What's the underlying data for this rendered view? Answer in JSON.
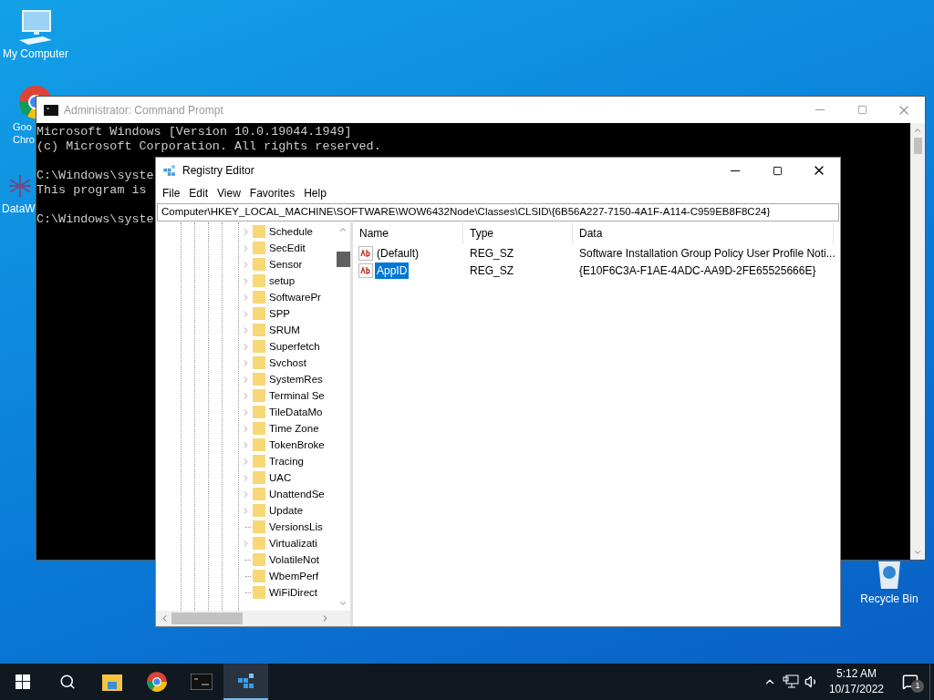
{
  "desktop_icons": [
    {
      "kind": "computer",
      "lines": [
        "My Computer"
      ]
    },
    {
      "kind": "chrome",
      "lines": [
        "Goo",
        "Chro"
      ]
    },
    {
      "kind": "datawave",
      "lines": [
        "DataW"
      ]
    },
    {
      "kind": "recycle",
      "lines": [
        "Recycle Bin"
      ]
    }
  ],
  "console": {
    "title": "Administrator: Command Prompt",
    "paragraphs": [
      [
        "Microsoft Windows [Version 10.0.19044.1949]",
        "(c) Microsoft Corporation. All rights reserved."
      ],
      [
        "C:\\Windows\\syste",
        "This program is"
      ],
      [
        "C:\\Windows\\syste"
      ]
    ]
  },
  "regedit": {
    "title": "Registry Editor",
    "menu": [
      "File",
      "Edit",
      "View",
      "Favorites",
      "Help"
    ],
    "address": "Computer\\HKEY_LOCAL_MACHINE\\SOFTWARE\\WOW6432Node\\Classes\\CLSID\\{6B56A227-7150-4A1F-A114-C959EB8F8C24}",
    "tree": [
      {
        "label": "Schedule",
        "has_children": true
      },
      {
        "label": "SecEdit",
        "has_children": true
      },
      {
        "label": "Sensor",
        "has_children": true
      },
      {
        "label": "setup",
        "has_children": true
      },
      {
        "label": "SoftwarePr",
        "has_children": true
      },
      {
        "label": "SPP",
        "has_children": true
      },
      {
        "label": "SRUM",
        "has_children": true
      },
      {
        "label": "Superfetch",
        "has_children": true
      },
      {
        "label": "Svchost",
        "has_children": true
      },
      {
        "label": "SystemRes",
        "has_children": true
      },
      {
        "label": "Terminal Se",
        "has_children": true
      },
      {
        "label": "TileDataMo",
        "has_children": true
      },
      {
        "label": "Time Zone",
        "has_children": true
      },
      {
        "label": "TokenBroke",
        "has_children": true
      },
      {
        "label": "Tracing",
        "has_children": true
      },
      {
        "label": "UAC",
        "has_children": true
      },
      {
        "label": "UnattendSe",
        "has_children": true
      },
      {
        "label": "Update",
        "has_children": true
      },
      {
        "label": "VersionsLis",
        "has_children": false
      },
      {
        "label": "Virtualizati",
        "has_children": true
      },
      {
        "label": "VolatileNot",
        "has_children": false
      },
      {
        "label": "WbemPerf",
        "has_children": false
      },
      {
        "label": "WiFiDirect",
        "has_children": false
      }
    ],
    "columns": [
      "Name",
      "Type",
      "Data"
    ],
    "values": [
      {
        "name": "(Default)",
        "type": "REG_SZ",
        "data": "Software Installation Group Policy User Profile Noti...",
        "selected": false
      },
      {
        "name": "AppID",
        "type": "REG_SZ",
        "data": "{E10F6C3A-F1AE-4ADC-AA9D-2FE65525666E}",
        "selected": true
      }
    ]
  },
  "taskbar": {
    "apps": [
      {
        "kind": "start",
        "active": false
      },
      {
        "kind": "search",
        "active": false
      },
      {
        "kind": "explorer",
        "active": false
      },
      {
        "kind": "chrome",
        "active": false
      },
      {
        "kind": "console",
        "active": false
      },
      {
        "kind": "regedit",
        "active": true
      }
    ],
    "time": "5:12 AM",
    "date": "10/17/2022",
    "notifications": "1"
  }
}
